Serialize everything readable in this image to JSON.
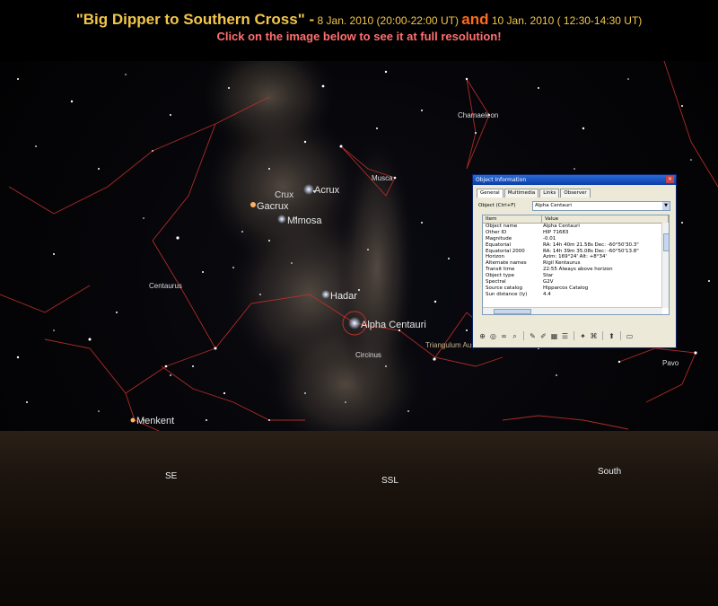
{
  "header": {
    "title_main": "\"Big Dipper to Southern Cross\" -",
    "date1": " 8 Jan. 2010 (20:00-22:00 UT) ",
    "and": "and",
    "date2": " 10 Jan. 2010 ( 12:30-14:30 UT)",
    "subtitle": "Click on the image below to see it at full resolution!"
  },
  "sky": {
    "stars_named": {
      "crux": "Crux",
      "acrux": "Acrux",
      "gacrux": "Gacrux",
      "mimosa": "Mimosa",
      "musca": "Musca",
      "hadar": "Hadar",
      "alpha_centauri": "Alpha Centauri",
      "menkent": "Menkent",
      "chamaeleon": "Chamaeleon",
      "circinus": "Circinus",
      "centaurus": "Centaurus",
      "triangulum_australe": "Triangulum Australe",
      "pavo": "Pavo"
    },
    "directions": {
      "se": "SE",
      "ssl": "SSL",
      "south": "South"
    }
  },
  "dialog": {
    "title": "Object Information",
    "close": "×",
    "tabs": [
      "General",
      "Multimedia",
      "Links",
      "Observer"
    ],
    "object_label": "Object  (Ctrl+F)",
    "object_value": "Alpha Centauri",
    "columns": [
      "Item",
      "Value"
    ],
    "rows": [
      [
        "Object name",
        "Alpha Centauri"
      ],
      [
        "Other ID",
        "HIP 71683"
      ],
      [
        "Magnitude",
        "-0.01"
      ],
      [
        "Equatorial",
        "RA: 14h 40m 21.58s   Dec: -60°50'30.3\""
      ],
      [
        "Equatorial 2000",
        "RA: 14h 39m 35.08s   Dec: -60°50'13.8\""
      ],
      [
        "Horizon",
        "Azim: 169°24'     Alt: +8°34'"
      ],
      [
        "Alternate names",
        "Rigil Kentaurus"
      ],
      [
        "Transit time",
        "22:55  Always above horizon"
      ],
      [
        "Object type",
        "Star"
      ],
      [
        "Spectral",
        "G2V"
      ],
      [
        "Source catalog",
        "Hipparcos Catalog"
      ],
      [
        "Sun distance (ly)",
        "4.4"
      ]
    ],
    "vscroll_fraction": 0.1,
    "hscroll_fraction": 0.1
  },
  "colors": {
    "title": "#f2c64a",
    "and": "#ff6a1a",
    "subtitle": "#ff6f6f",
    "constellation_lines": "#c0302a"
  }
}
